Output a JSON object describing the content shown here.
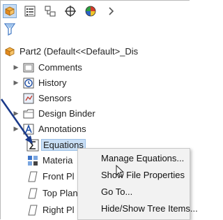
{
  "tree": {
    "root_label": "Part2  (Default<<Default>_Dis",
    "items": [
      {
        "label": "Comments"
      },
      {
        "label": "History"
      },
      {
        "label": "Sensors"
      },
      {
        "label": "Design Binder"
      },
      {
        "label": "Annotations"
      },
      {
        "label": "Equations"
      },
      {
        "label": "Materia"
      },
      {
        "label": "Front Pl"
      },
      {
        "label": "Top Plan"
      },
      {
        "label": "Right Pl"
      }
    ]
  },
  "context_menu": {
    "items": [
      {
        "label": "Manage Equations..."
      },
      {
        "label": "Show File Properties"
      },
      {
        "label": "Go To..."
      },
      {
        "label": "Hide/Show Tree Items..."
      }
    ]
  },
  "colors": {
    "accent": "#1f6fd0",
    "selection": "#c8def5",
    "arrow": "#1a3a8a"
  }
}
